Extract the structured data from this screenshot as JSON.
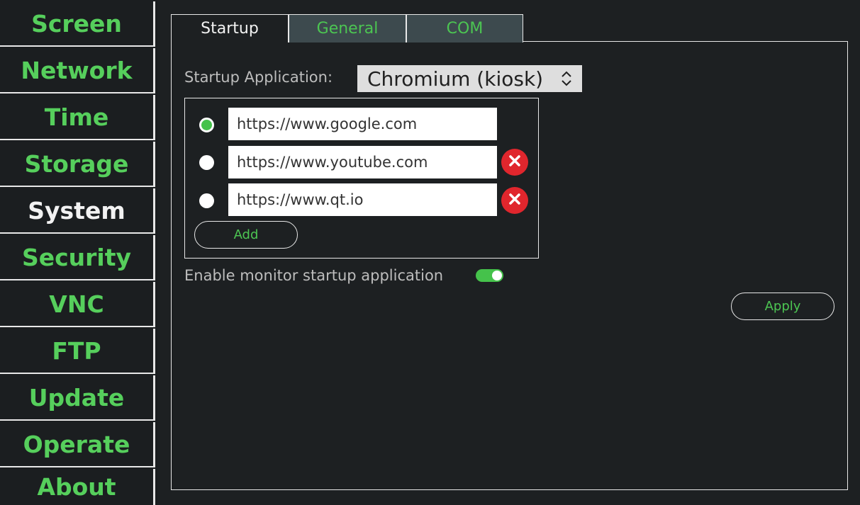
{
  "sidebar": {
    "items": [
      {
        "label": "Screen"
      },
      {
        "label": "Network"
      },
      {
        "label": "Time"
      },
      {
        "label": "Storage"
      },
      {
        "label": "System",
        "active": true
      },
      {
        "label": "Security"
      },
      {
        "label": "VNC"
      },
      {
        "label": "FTP"
      },
      {
        "label": "Update"
      },
      {
        "label": "Operate"
      },
      {
        "label": "About"
      }
    ]
  },
  "tabs": [
    {
      "label": "Startup",
      "active": true
    },
    {
      "label": "General"
    },
    {
      "label": "COM"
    }
  ],
  "startup": {
    "app_label": "Startup Application:",
    "app_value": "Chromium (kiosk)",
    "urls": [
      {
        "value": "https://www.google.com",
        "selected": true,
        "deletable": false
      },
      {
        "value": "https://www.youtube.com",
        "selected": false,
        "deletable": true
      },
      {
        "value": "https://www.qt.io",
        "selected": false,
        "deletable": true
      }
    ],
    "add_label": "Add",
    "monitor_label": "Enable monitor startup application",
    "monitor_enabled": true,
    "apply_label": "Apply"
  },
  "icons": {
    "delete": "close-circle-icon",
    "select_arrows": "chevron-up-down-icon"
  },
  "colors": {
    "accent": "#4cc552",
    "background": "#1d2022",
    "inactive_tab": "#3d4a4e",
    "delete": "#e0262d"
  }
}
